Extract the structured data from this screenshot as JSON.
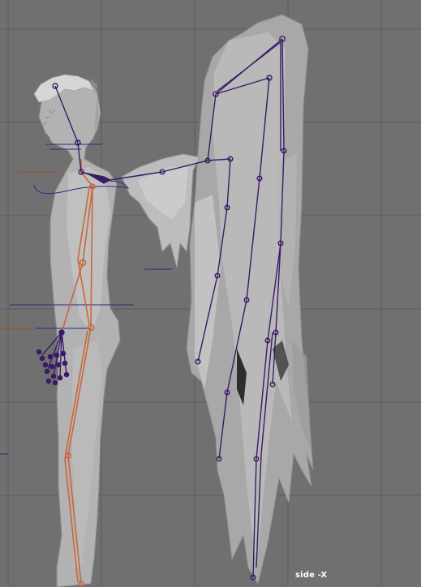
{
  "viewport": {
    "view_label": "side -X",
    "background_color": "#707070",
    "grid_color": "#5a5a5a",
    "mesh_color": "#a9a9a9",
    "mesh_light_color": "#c4c4c4",
    "skeleton_body_color": "#c8663c",
    "skeleton_wing_color": "#3a1a66",
    "control_curve_color": "#2a2a88",
    "ik_handle_color": "#a14b2d"
  }
}
